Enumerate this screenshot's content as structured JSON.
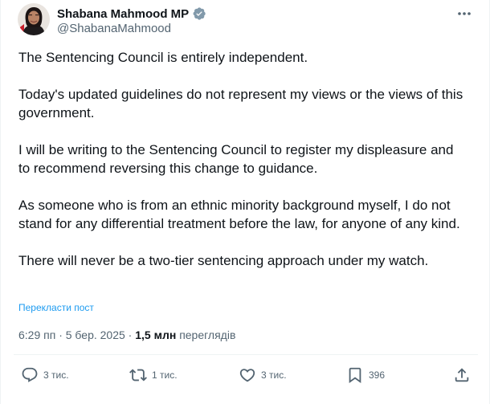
{
  "author": {
    "display_name": "Shabana Mahmood MP",
    "handle": "@ShabanaMahmood",
    "verified_icon": "verified-badge-icon",
    "badge_color": "#829aab"
  },
  "tweet": {
    "paragraphs": [
      "The Sentencing Council is entirely independent.",
      "Today's updated guidelines do not represent my views or the views of this government.",
      "I will be writing to the Sentencing Council to register my displeasure and to recommend reversing this change to guidance.",
      "As someone who is from an ethnic minority background myself, I do not stand for any differential treatment before the law, for anyone of any kind.",
      "There will never be a two-tier sentencing approach under my watch."
    ],
    "translate_label": "Перекласти пост",
    "timestamp": "6:29 пп · 5 бер. 2025",
    "separator": " · ",
    "views_count": "1,5 млн",
    "views_label": "переглядів"
  },
  "actions": {
    "replies": "3 тис.",
    "retweets": "1 тис.",
    "likes": "3 тис.",
    "bookmarks": "396"
  },
  "colors": {
    "text": "#0f1419",
    "secondary": "#536471",
    "link": "#1d9bf0"
  }
}
